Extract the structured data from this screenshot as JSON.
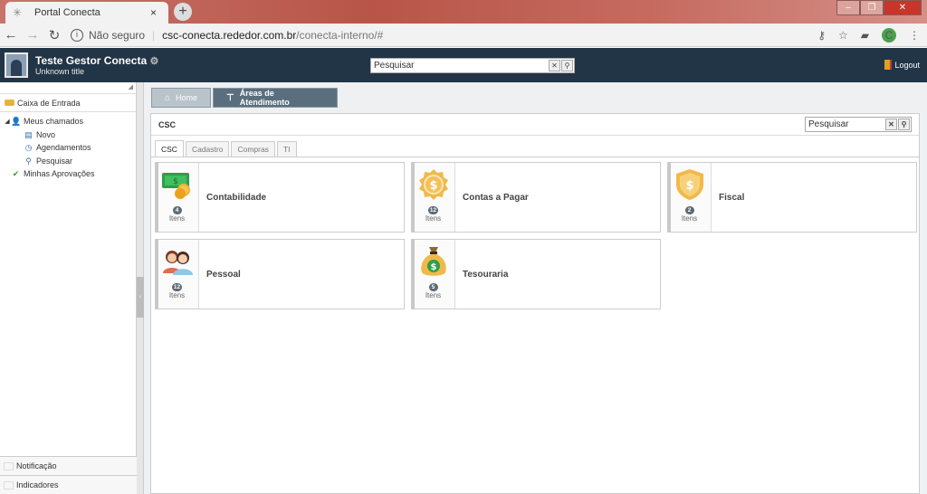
{
  "browser": {
    "tab_title": "Portal Conecta",
    "tab_close": "×",
    "new_tab": "+",
    "not_secure": "Não seguro",
    "url_host": "csc-conecta.rededor.com.br",
    "url_path": "/conecta-interno/#",
    "profile_initial": "C"
  },
  "header": {
    "user_name": "Teste Gestor Conecta",
    "user_title": "Unknown title",
    "search_value": "Pesquisar",
    "logout_label": "Logout"
  },
  "sidebar": {
    "inbox_label": "Caixa de Entrada",
    "tree": [
      {
        "label": "Meus chamados",
        "icon": "user-group-icon",
        "level": 0,
        "toggle": "◢"
      },
      {
        "label": "Novo",
        "icon": "new-doc-icon",
        "level": 1
      },
      {
        "label": "Agendamentos",
        "icon": "clock-icon",
        "level": 1
      },
      {
        "label": "Pesquisar",
        "icon": "search-icon",
        "level": 1
      },
      {
        "label": "Minhas Aprovações",
        "icon": "check-icon",
        "level": 0
      }
    ],
    "bottom": [
      {
        "label": "Notificação",
        "icon": "mail-icon"
      },
      {
        "label": "Indicadores",
        "icon": "chart-icon"
      }
    ]
  },
  "breadcrumbs": {
    "home": "Home",
    "areas": "Áreas de Atendimento"
  },
  "panel": {
    "title": "CSC",
    "search_value": "Pesquisar",
    "tabs": [
      "CSC",
      "Cadastro",
      "Compras",
      "TI"
    ],
    "active_tab": "CSC",
    "items_label": "Itens",
    "cards": [
      {
        "name": "Contabilidade",
        "count": "4",
        "icon": "money-icon"
      },
      {
        "name": "Contas a Pagar",
        "count": "12",
        "icon": "coin-icon"
      },
      {
        "name": "Fiscal",
        "count": "2",
        "icon": "shield-dollar-icon"
      },
      {
        "name": "Pessoal",
        "count": "12",
        "icon": "people-icon"
      },
      {
        "name": "Tesouraria",
        "count": "5",
        "icon": "money-bag-icon"
      }
    ]
  },
  "colors": {
    "header_bg": "#223547",
    "breadcrumb_active": "#5a6e7d",
    "badge": "#5d6b75"
  }
}
